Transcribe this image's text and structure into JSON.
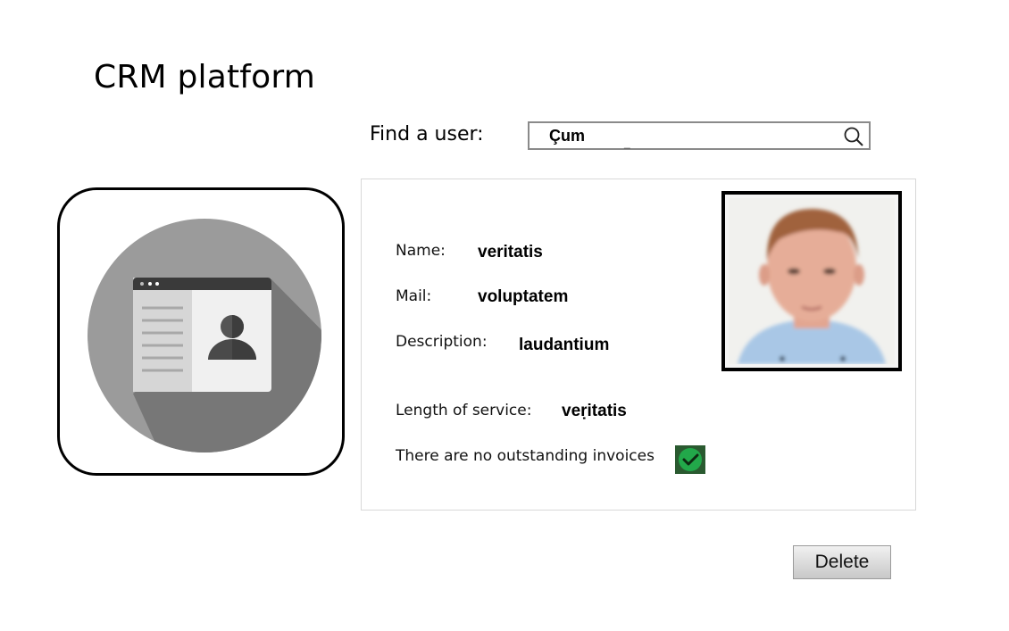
{
  "app": {
    "title": "CRM platform"
  },
  "search": {
    "label": "Find a user:",
    "value": "Çum",
    "cursor": "_",
    "icon": "search-icon"
  },
  "profile": {
    "name_label": "Name:",
    "name_value": "veritatis",
    "mail_label": "Mail:",
    "mail_value": "voluptatem",
    "description_label": "Description:",
    "description_value": "laudantium",
    "service_label": "Length of service:",
    "service_value": "veṛitatis",
    "invoices_text": "There are no outstanding invoices",
    "invoices_icon": "check-icon",
    "invoices_status_color": "#22a84a",
    "photo": "user-photo"
  },
  "app_icon": "contact-card-icon",
  "actions": {
    "delete_label": "Delete"
  }
}
